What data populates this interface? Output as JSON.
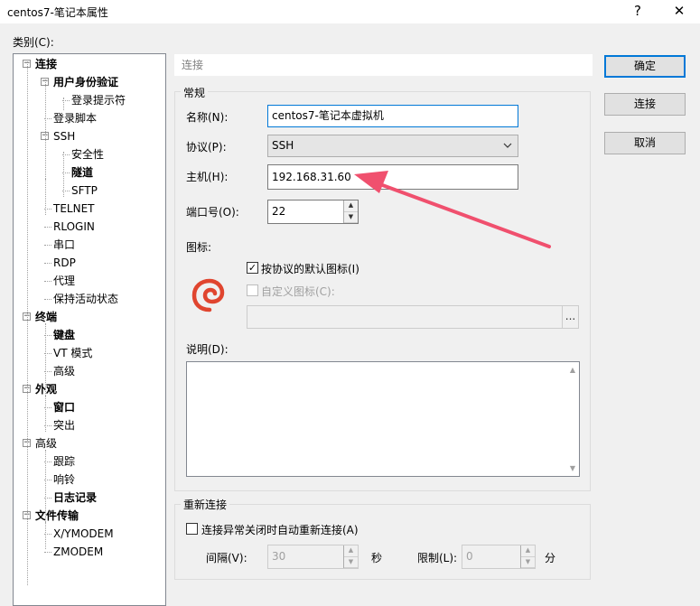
{
  "window": {
    "title": "centos7-笔记本属性",
    "help_glyph": "?",
    "close_glyph": "✕"
  },
  "sidebar": {
    "category_label": "类别(C):",
    "items": [
      {
        "label": "连接",
        "bold": true,
        "toggle": "−"
      },
      {
        "label": "用户身份验证",
        "bold": true,
        "toggle": "−"
      },
      {
        "label": "登录提示符",
        "bold": false
      },
      {
        "label": "登录脚本",
        "bold": false
      },
      {
        "label": "SSH",
        "bold": false,
        "toggle": "−"
      },
      {
        "label": "安全性",
        "bold": false
      },
      {
        "label": "隧道",
        "bold": true
      },
      {
        "label": "SFTP",
        "bold": false
      },
      {
        "label": "TELNET",
        "bold": false
      },
      {
        "label": "RLOGIN",
        "bold": false
      },
      {
        "label": "串口",
        "bold": false
      },
      {
        "label": "RDP",
        "bold": false
      },
      {
        "label": "代理",
        "bold": false
      },
      {
        "label": "保持活动状态",
        "bold": false
      },
      {
        "label": "终端",
        "bold": true,
        "toggle": "−"
      },
      {
        "label": "键盘",
        "bold": true
      },
      {
        "label": "VT 模式",
        "bold": false
      },
      {
        "label": "高级",
        "bold": false
      },
      {
        "label": "外观",
        "bold": true,
        "toggle": "−"
      },
      {
        "label": "窗口",
        "bold": true
      },
      {
        "label": "突出",
        "bold": false
      },
      {
        "label": "高级",
        "bold": false,
        "toggle": "−"
      },
      {
        "label": "跟踪",
        "bold": false
      },
      {
        "label": "响铃",
        "bold": false
      },
      {
        "label": "日志记录",
        "bold": true
      },
      {
        "label": "文件传输",
        "bold": true,
        "toggle": "−"
      },
      {
        "label": "X/YMODEM",
        "bold": false
      },
      {
        "label": "ZMODEM",
        "bold": false
      }
    ]
  },
  "main": {
    "breadcrumb": "连接",
    "general_group_title": "常规",
    "name_label": "名称(N):",
    "name_value": "centos7-笔记本虚拟机",
    "protocol_label": "协议(P):",
    "protocol_value": "SSH",
    "host_label": "主机(H):",
    "host_value": "192.168.31.60",
    "port_label": "端口号(O):",
    "port_value": "22",
    "icon_label": "图标:",
    "use_default_icon_label": "按协议的默认图标(I)",
    "use_default_icon_checked": true,
    "custom_icon_label": "自定义图标(C):",
    "custom_icon_checked": false,
    "browse_glyph": "...",
    "description_label": "说明(D):",
    "description_value": "",
    "reconnect_group_title": "重新连接",
    "auto_reconnect_label": "连接异常关闭时自动重新连接(A)",
    "auto_reconnect_checked": false,
    "interval_label": "间隔(V):",
    "interval_value": "30",
    "interval_unit": "秒",
    "limit_label": "限制(L):",
    "limit_value": "0",
    "limit_unit": "分"
  },
  "buttons": {
    "ok": "确定",
    "connect": "连接",
    "cancel": "取消"
  },
  "colors": {
    "arrow": "#f0506e",
    "accent": "#0078d7",
    "session_icon": "#e0452f"
  }
}
